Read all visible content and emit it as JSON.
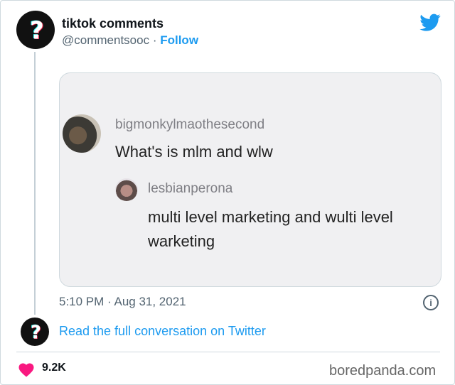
{
  "tweet": {
    "display_name": "tiktok comments",
    "handle": "@commentsooc",
    "separator": "·",
    "follow_label": "Follow",
    "timestamp": "5:10 PM · Aug 31, 2021",
    "read_link": "Read the full conversation on Twitter",
    "likes": "9.2K"
  },
  "embedded_image": {
    "comment1": {
      "username": "bigmonkylmaothesecond",
      "text": "What's is mlm and wlw"
    },
    "comment2": {
      "username": "lesbianperona",
      "text": "multi level marketing and wulti level warketing"
    }
  },
  "watermark": "boredpanda.com",
  "icons": {
    "avatar": "tiktok-question-mark-icon",
    "brand": "twitter-bird-icon",
    "info": "info-icon",
    "like": "heart-icon"
  },
  "colors": {
    "link": "#1d9bf0",
    "heart": "#f91880",
    "muted": "#536471"
  }
}
